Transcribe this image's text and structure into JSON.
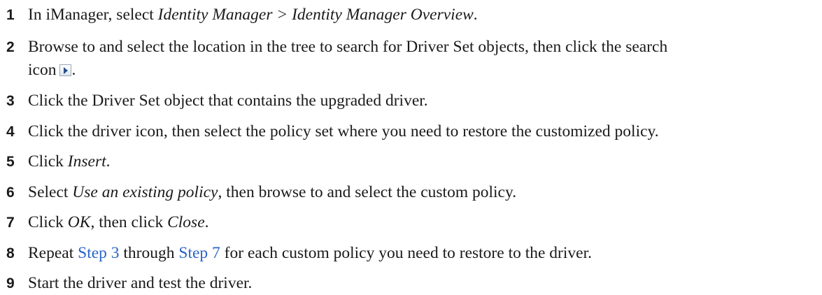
{
  "steps": [
    {
      "num": "1",
      "t1": "In iManager, select ",
      "e1": "Identity Manager > Identity Manager Overview",
      "t2": "."
    },
    {
      "num": "2",
      "t1": "Browse to and select the location in the tree to search for Driver Set objects, then click the search",
      "t2": "icon",
      "t3": "."
    },
    {
      "num": "3",
      "t1": "Click the Driver Set object that contains the upgraded driver."
    },
    {
      "num": "4",
      "t1": "Click the driver icon, then select the policy set where you need to restore the customized policy."
    },
    {
      "num": "5",
      "t1": "Click ",
      "e1": "Insert",
      "t2": "."
    },
    {
      "num": "6",
      "t1": "Select ",
      "e1": "Use an existing policy",
      "t2": ", then browse to and select the custom policy."
    },
    {
      "num": "7",
      "t1": "Click ",
      "e1": "OK",
      "t2": ", then click ",
      "e2": "Close",
      "t3": "."
    },
    {
      "num": "8",
      "t1": "Repeat ",
      "l1": "Step 3",
      "t2": " through ",
      "l2": "Step 7",
      "t3": " for each custom policy you need to restore to the driver."
    },
    {
      "num": "9",
      "t1": "Start the driver and test the driver."
    }
  ],
  "icons": {
    "search": "search-icon"
  }
}
